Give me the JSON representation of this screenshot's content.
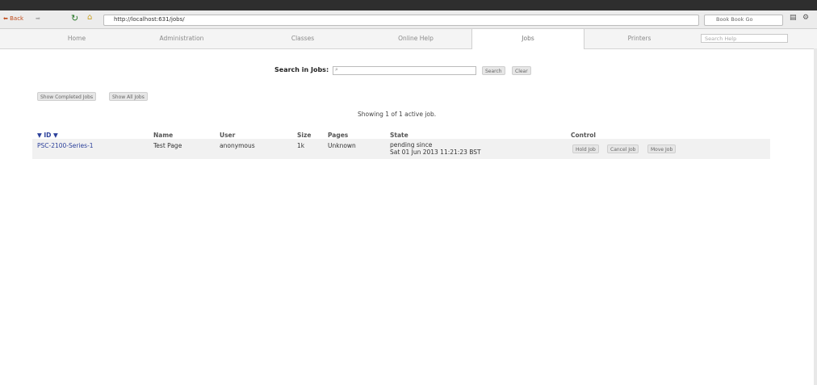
{
  "browser": {
    "back_label": "Back",
    "address": "http://localhost:631/jobs/",
    "search_placeholder": "Book Book Go"
  },
  "nav": {
    "tabs": [
      "Home",
      "Administration",
      "Classes",
      "Online Help",
      "Jobs",
      "Printers"
    ],
    "active_tab": "Jobs",
    "search_placeholder": "Search Help"
  },
  "search": {
    "label": "Search in Jobs:",
    "value": "",
    "search_button": "Search",
    "clear_button": "Clear"
  },
  "job_filters": {
    "show_completed": "Show Completed Jobs",
    "show_all": "Show All Jobs"
  },
  "status_text": "Showing 1 of 1 active job.",
  "table": {
    "headers": {
      "id": "▼ ID ▼",
      "name": "Name",
      "user": "User",
      "size": "Size",
      "pages": "Pages",
      "state": "State",
      "control": "Control"
    },
    "rows": [
      {
        "id": "PSC-2100-Series-1",
        "name": "Test Page",
        "user": "anonymous",
        "size": "1k",
        "pages": "Unknown",
        "state_line1": "pending since",
        "state_line2": "Sat 01 Jun 2013 11:21:23 BST",
        "controls": [
          "Hold Job",
          "Cancel Job",
          "Move Job"
        ]
      }
    ]
  },
  "colors": {
    "link": "#2a3f9a",
    "topbar": "#2e2e2e"
  }
}
